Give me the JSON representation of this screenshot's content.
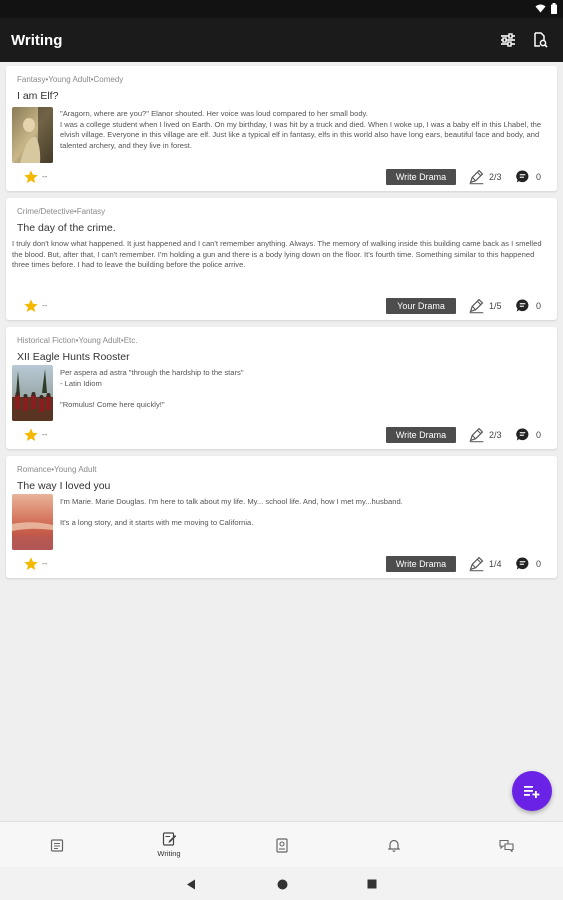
{
  "app": {
    "title": "Writing"
  },
  "appbar": {
    "actions": [
      {
        "icon": "filter-sliders-icon"
      },
      {
        "icon": "document-search-icon"
      }
    ]
  },
  "colors": {
    "accent": "#6a22e6",
    "appbar": "#1b1b1b",
    "button": "#4d4d4d",
    "star": "#f5b800"
  },
  "stories": [
    {
      "genre": "Fantasy•Young Adult•Comedy",
      "title": "I am Elf?",
      "excerpt": [
        "\"Aragorn, where are you?\" Elanor shouted. Her voice was loud compared to her small body.\nI was a college student when I lived on Earth. On my birthday, I was hit by a truck and died. When I woke up, I was a baby elf in this Lhabel, the elvish village. Everyone in this village are elf. Just like a typical elf in fantasy, elfs in this world also have long ears, beautiful face and body, and talented archery, and they live in forest."
      ],
      "rating": "--",
      "button": "Write Drama",
      "drama_count": "2/3",
      "comment_count": "0"
    },
    {
      "genre": "Crime/Detective•Fantasy",
      "title": "The day of the crime.",
      "excerpt": [
        "I truly don't know what happened. It just happened and I can't remember anything. Always. The memory of walking inside this building came back as I smelled the blood. But, after that, I can't remember. I'm holding a gun and there is a body lying down on the floor. It's fourth time. Something similar to this happened three times before. I had to leave the building before the police arrive."
      ],
      "rating": "--",
      "button": "Your Drama",
      "drama_count": "1/5",
      "comment_count": "0"
    },
    {
      "genre": "Historical Fiction•Young Adult•Etc.",
      "title": "XII Eagle Hunts Rooster",
      "excerpt": [
        "Per aspera ad astra \"through the hardship to the stars\"\n- Latin Idiom",
        "\"Romulus! Come here quickly!\""
      ],
      "rating": "--",
      "button": "Write Drama",
      "drama_count": "2/3",
      "comment_count": "0"
    },
    {
      "genre": "Romance•Young Adult",
      "title": "The way I loved you",
      "excerpt": [
        "I'm Marie. Marie Douglas. I'm here to talk about my life. My... school life. And, how I met my...husband.",
        "It's a long story, and it starts with me moving to California."
      ],
      "rating": "--",
      "button": "Write Drama",
      "drama_count": "1/4",
      "comment_count": "0"
    }
  ],
  "bottom_nav": [
    {
      "icon": "feed-list-icon",
      "label": ""
    },
    {
      "icon": "writing-edit-icon",
      "label": "Writing"
    },
    {
      "icon": "profile-badge-icon",
      "label": ""
    },
    {
      "icon": "bell-icon",
      "label": ""
    },
    {
      "icon": "chat-bubbles-icon",
      "label": ""
    }
  ],
  "fab": {
    "icon": "add-list-icon"
  }
}
